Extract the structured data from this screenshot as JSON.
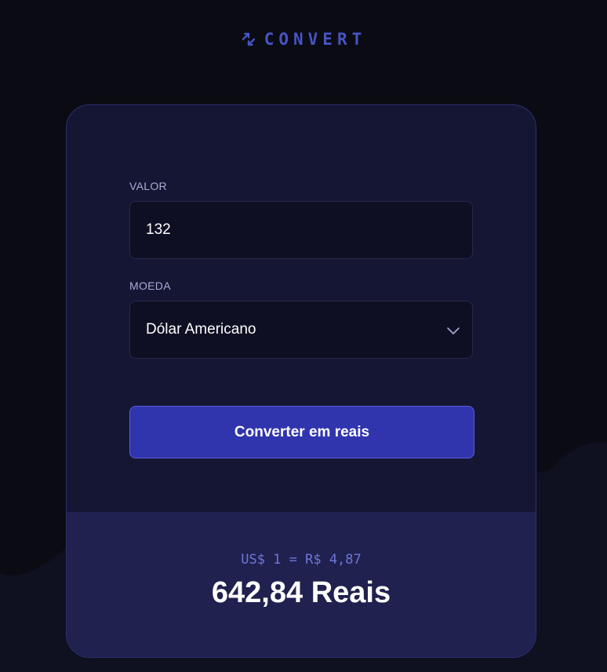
{
  "brand": {
    "name": "CONVERT",
    "icon": "arrows-exchange-icon",
    "color": "#4654c4"
  },
  "form": {
    "valor": {
      "label": "VALOR",
      "value": "132"
    },
    "moeda": {
      "label": "MOEDA",
      "selected": "Dólar Americano",
      "icon": "chevron-down-icon"
    },
    "submit_label": "Converter em reais"
  },
  "result": {
    "rate": "US$ 1 = R$ 4,87",
    "total": "642,84 Reais"
  },
  "colors": {
    "background": "#0b0b14",
    "card": "#151634",
    "result_panel": "#20214f",
    "button": "#3034ad",
    "accent": "#6d76d8"
  }
}
